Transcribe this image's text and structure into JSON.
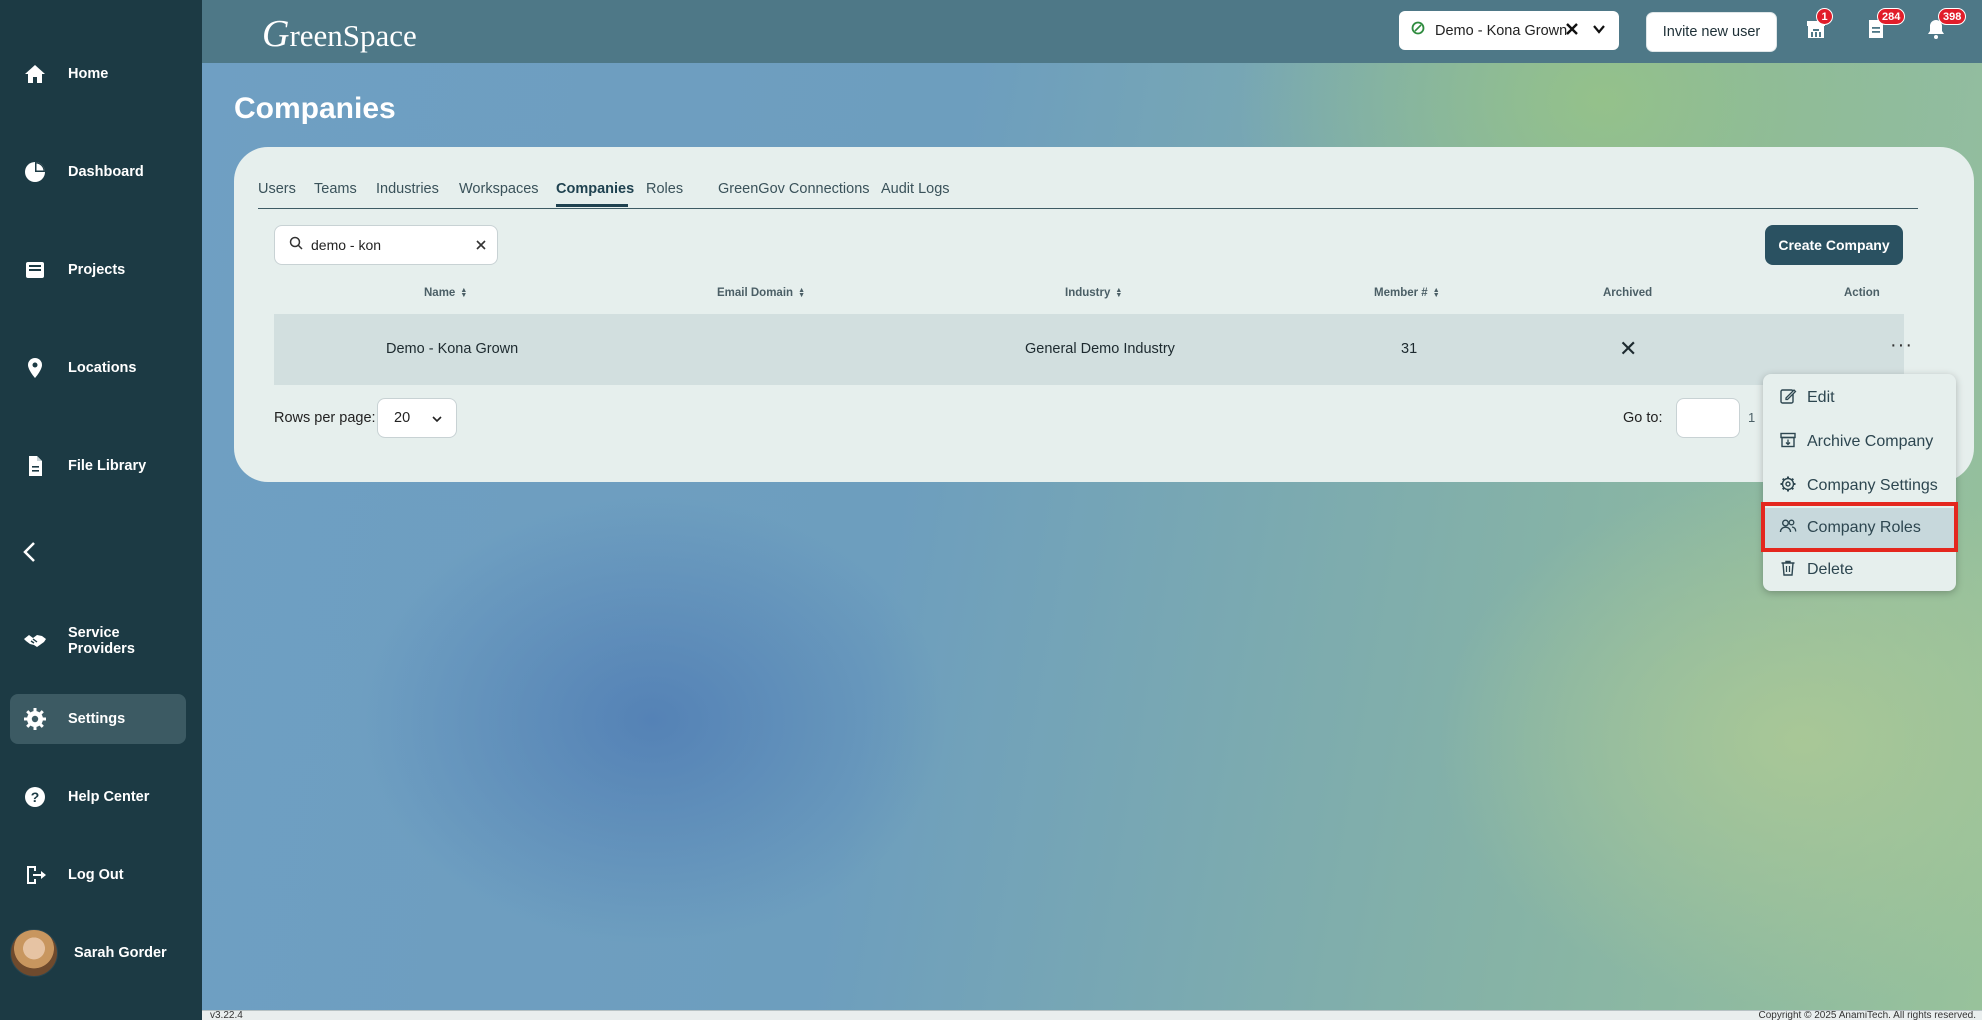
{
  "sidebar": {
    "items": [
      {
        "label": "Home",
        "icon": "home-icon"
      },
      {
        "label": "Dashboard",
        "icon": "pie-chart-icon"
      },
      {
        "label": "Projects",
        "icon": "inbox-icon"
      },
      {
        "label": "Locations",
        "icon": "map-pin-icon"
      },
      {
        "label": "File Library",
        "icon": "file-icon"
      },
      {
        "label": "Service Providers",
        "icon": "handshake-icon"
      },
      {
        "label": "Settings",
        "icon": "gear-icon",
        "active": true
      },
      {
        "label": "Help Center",
        "icon": "question-icon"
      },
      {
        "label": "Log Out",
        "icon": "logout-icon"
      }
    ],
    "user": {
      "name": "Sarah Gorder"
    }
  },
  "header": {
    "logo": "reenSpace",
    "logo_initial": "G",
    "company_select": {
      "value": "Demo - Kona Grown"
    },
    "invite_label": "Invite new user",
    "badges": {
      "inbox": "1",
      "documents": "284",
      "notifications": "398"
    }
  },
  "page": {
    "title": "Companies"
  },
  "tabs": [
    {
      "label": "Users"
    },
    {
      "label": "Teams"
    },
    {
      "label": "Industries"
    },
    {
      "label": "Workspaces"
    },
    {
      "label": "Companies",
      "active": true
    },
    {
      "label": "Roles"
    },
    {
      "label": "GreenGov Connections"
    },
    {
      "label": "Audit Logs"
    }
  ],
  "search": {
    "value": "demo - kon"
  },
  "create_label": "Create Company",
  "table": {
    "columns": [
      "Name",
      "Email Domain",
      "Industry",
      "Member #",
      "Archived",
      "Action"
    ],
    "rows": [
      {
        "name": "Demo - Kona Grown",
        "email_domain": "",
        "industry": "General Demo Industry",
        "members": "31",
        "archived": "✕",
        "action": "···"
      }
    ]
  },
  "pagination": {
    "rows_label": "Rows per page:",
    "rows_value": "20",
    "goto_label": "Go to:",
    "page": "1"
  },
  "menu": {
    "items": [
      {
        "label": "Edit",
        "icon": "edit-icon"
      },
      {
        "label": "Archive Company",
        "icon": "archive-icon"
      },
      {
        "label": "Company Settings",
        "icon": "gear-icon"
      },
      {
        "label": "Company Roles",
        "icon": "users-icon",
        "highlighted": true
      },
      {
        "label": "Delete",
        "icon": "trash-icon"
      }
    ]
  },
  "footer": {
    "version": "v3.22.4",
    "copyright": "Copyright © 2025 AnamiTech. All rights reserved."
  },
  "colors": {
    "sidebar": "#1c3a44",
    "header": "#4e7887",
    "primary_button": "#2a5161",
    "badge": "#e11d2a",
    "highlight": "#e4271e"
  }
}
